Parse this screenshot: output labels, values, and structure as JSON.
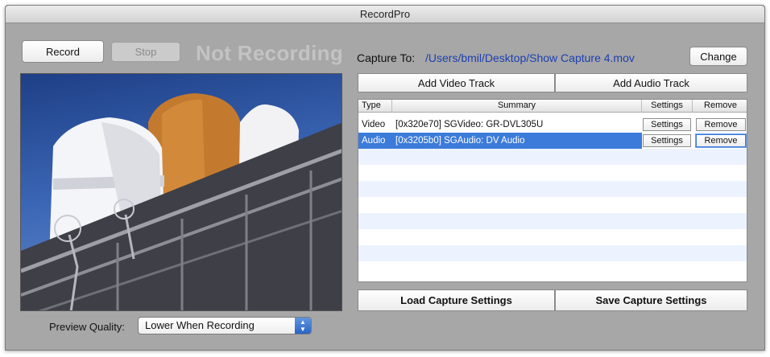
{
  "window": {
    "title": "RecordPro"
  },
  "toolbar": {
    "record_label": "Record",
    "stop_label": "Stop",
    "status": "Not Recording"
  },
  "capture": {
    "label": "Capture To:",
    "path": "/Users/bmil/Desktop/Show Capture 4.mov",
    "change_label": "Change"
  },
  "tracks": {
    "add_video_label": "Add Video Track",
    "add_audio_label": "Add Audio Track",
    "columns": [
      "Type",
      "Summary",
      "Settings",
      "Remove"
    ],
    "rows": [
      {
        "type": "Video",
        "summary": "[0x320e70] SGVideo: GR-DVL305U",
        "settings_label": "Settings",
        "remove_label": "Remove",
        "selected": false
      },
      {
        "type": "Audio",
        "summary": "[0x3205b0] SGAudio: DV Audio",
        "settings_label": "Settings",
        "remove_label": "Remove",
        "selected": true
      }
    ]
  },
  "settings": {
    "load_label": "Load Capture Settings",
    "save_label": "Save Capture Settings"
  },
  "preview": {
    "quality_label": "Preview Quality:",
    "quality_value": "Lower When Recording"
  },
  "colors": {
    "window_bg": "#a7a7a7",
    "selection": "#3c7bd9",
    "path_link": "#1c3fb0",
    "status_text": "#c3c3c3"
  }
}
